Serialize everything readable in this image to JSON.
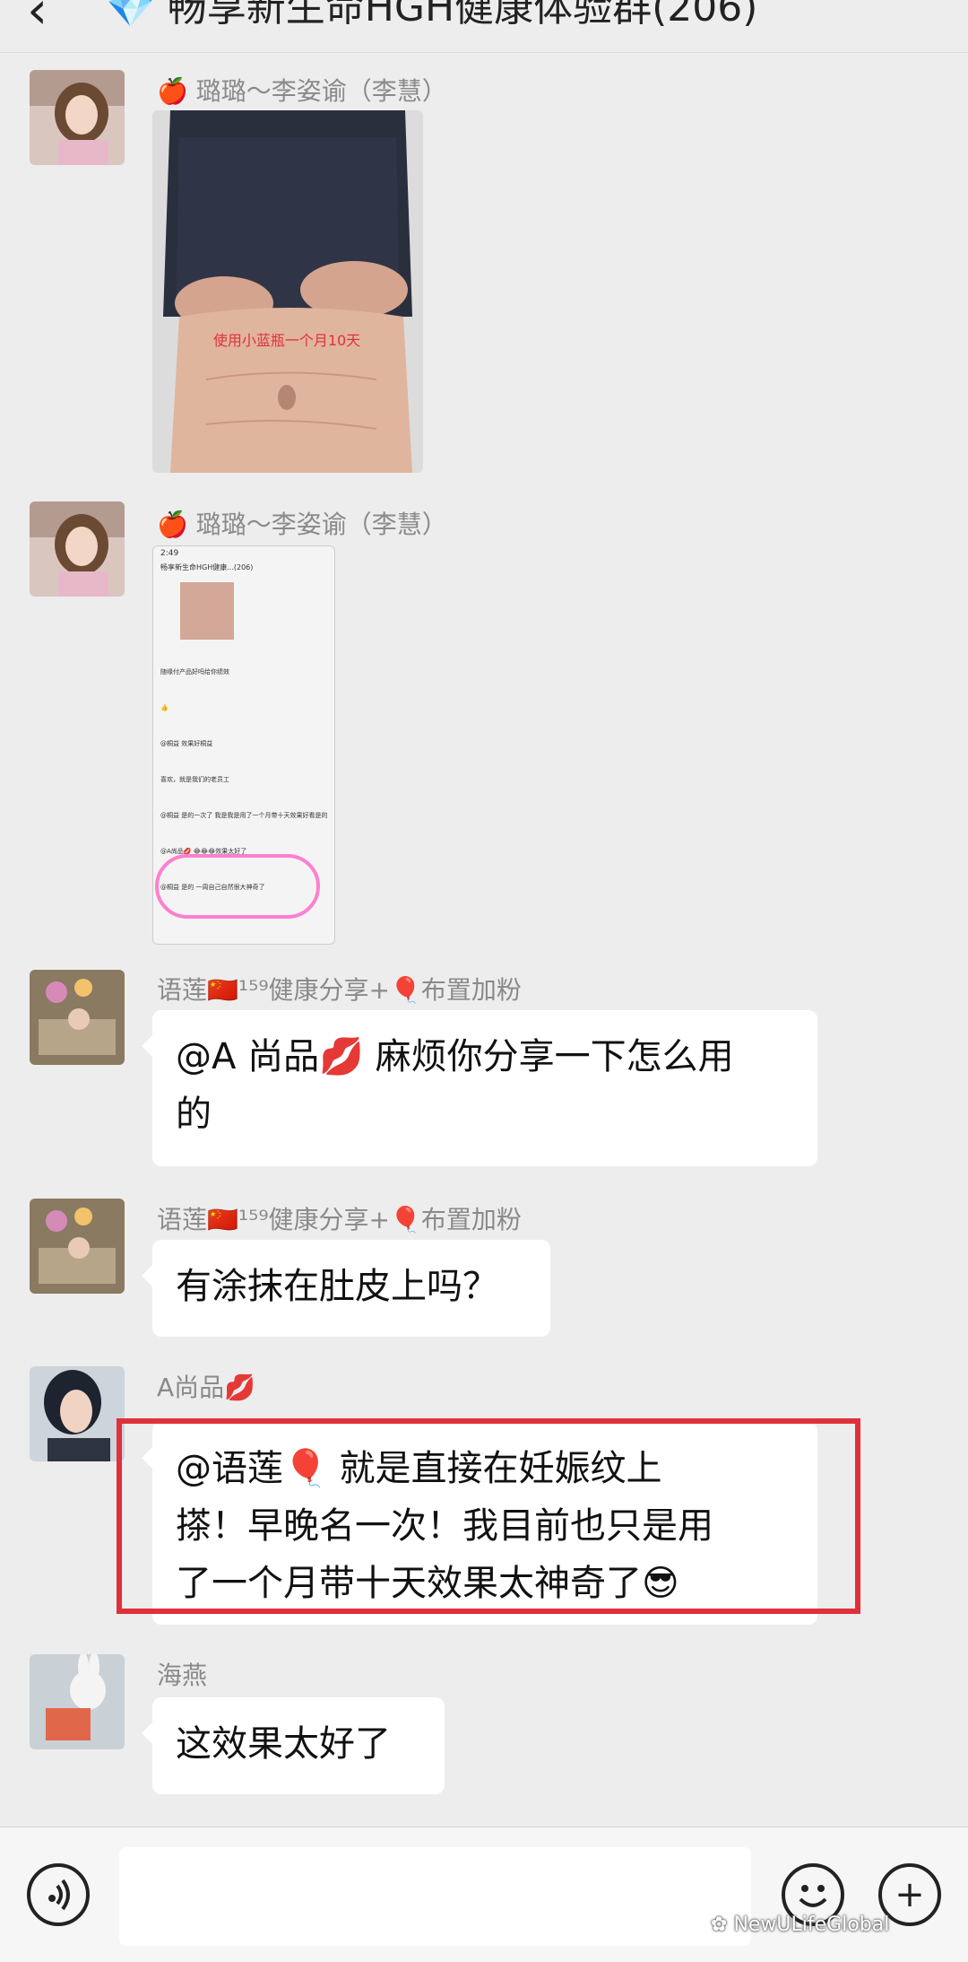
{
  "header": {
    "back_icon": "‹",
    "title": "畅享新生命HGH健康体验群(206)",
    "diamond_icon": "💎"
  },
  "messages": [
    {
      "sender": "🍎 璐璐～李姿谕（李慧）",
      "type": "image",
      "image_caption": "使用小蓝瓶一个月10天"
    },
    {
      "sender": "🍎 璐璐～李姿谕（李慧）",
      "type": "image",
      "screenshot": {
        "status_time": "2:49",
        "title": "畅享新生命HGH健康...(206)",
        "lines": [
          "随缘付产品好吗给你绩效",
          "👍",
          "@桐益 效果好桐益",
          "喜欢，就是我们的老员工",
          "@桐益 是的一次了 我是我是用了一个月带十天效果好看是的",
          "@A尚品💋 😂😂😂效果太好了",
          "@桐益 是的 一周自己自然很大神奇了"
        ]
      }
    },
    {
      "sender": "语莲🇨🇳¹⁵⁹健康分享+🎈布置加粉",
      "type": "text",
      "lines": [
        "@A 尚品💋  麻烦你分享一下怎么用",
        "的"
      ]
    },
    {
      "sender": "语莲🇨🇳¹⁵⁹健康分享+🎈布置加粉",
      "type": "text",
      "lines": [
        "有涂抹在肚皮上吗？"
      ]
    },
    {
      "sender": "A尚品💋",
      "type": "text",
      "lines": [
        "@语莲🎈  就是直接在妊娠纹上",
        "搽！早晚名一次！我目前也只是用",
        "了一个月带十天效果太神奇了😎"
      ]
    },
    {
      "sender": "海燕",
      "type": "text",
      "lines": [
        "这效果太好了"
      ]
    }
  ],
  "bottom": {
    "voice_icon": "voice-icon",
    "emoji_icon": "smiley-icon",
    "plus_icon": "+",
    "watermark": "NewULifeGlobal"
  },
  "colors": {
    "highlight": "#e0303a",
    "background": "#ededed",
    "bubble": "#ffffff"
  }
}
